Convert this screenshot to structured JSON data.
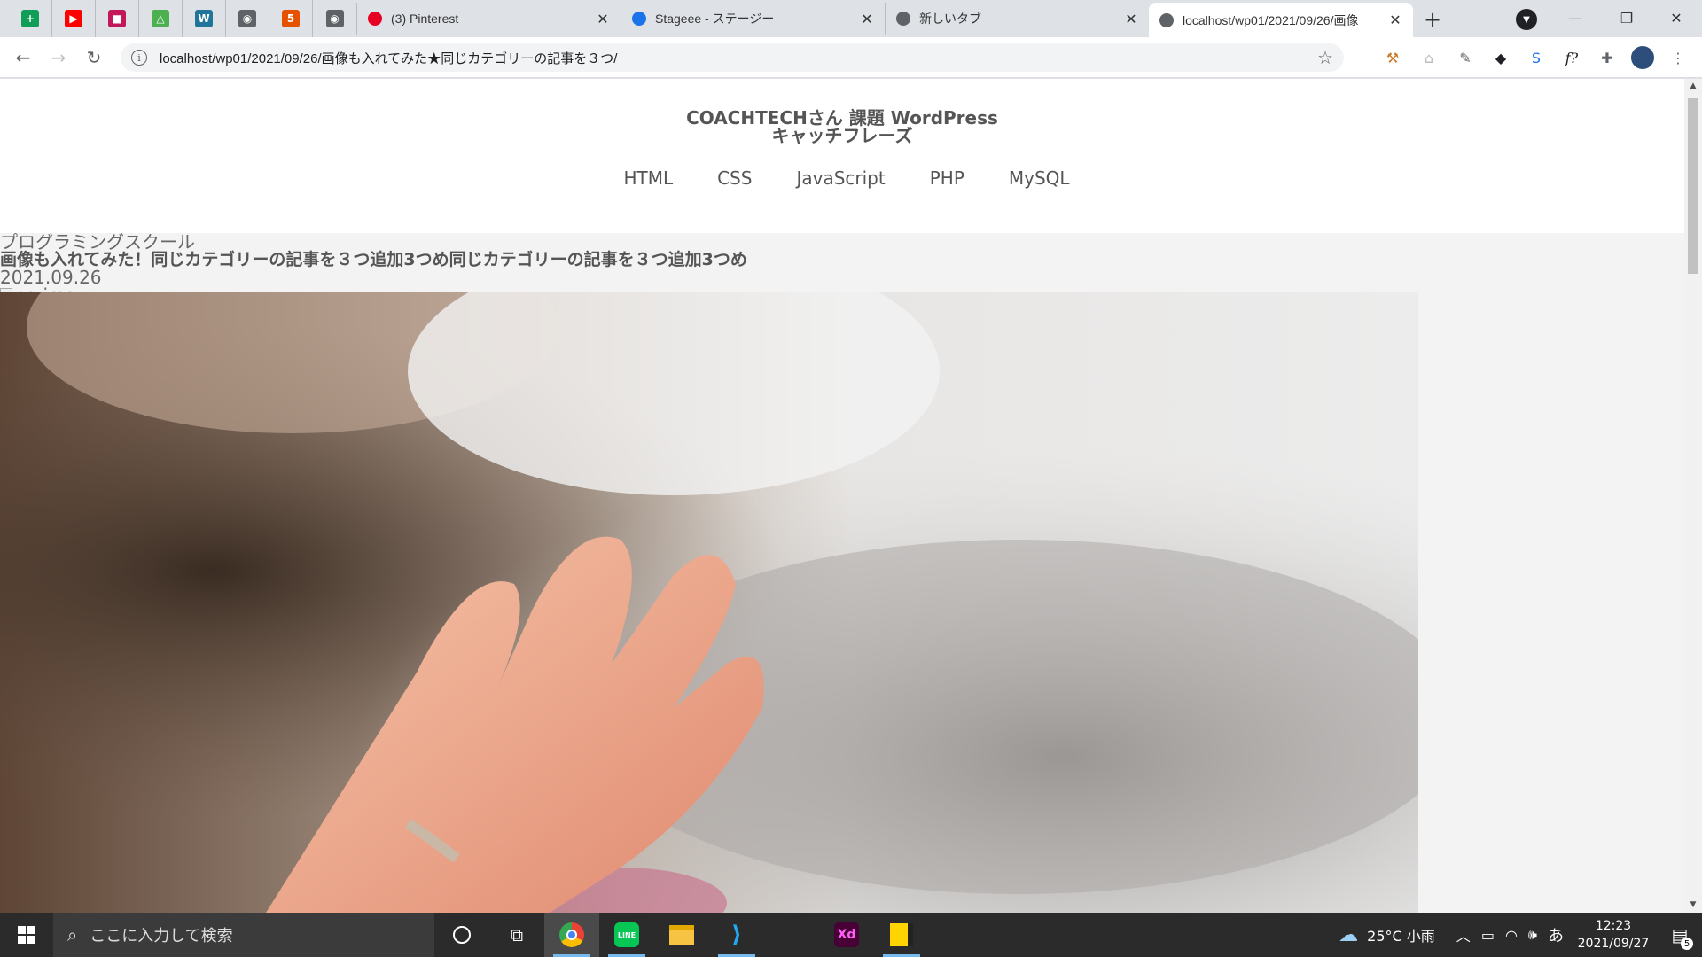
{
  "browser": {
    "pinned_tabs": [
      {
        "icon": "google-sheets-icon",
        "color": "#0f9d58",
        "glyph": "+"
      },
      {
        "icon": "youtube-icon",
        "color": "#ff0000",
        "glyph": "▶"
      },
      {
        "icon": "book-icon",
        "color": "#c2185b",
        "glyph": "■"
      },
      {
        "icon": "drive-icon",
        "color": "#4caf50",
        "glyph": "△"
      },
      {
        "icon": "wordpress-icon",
        "color": "#21759b",
        "glyph": "W"
      },
      {
        "icon": "globe-icon",
        "color": "#5f6368",
        "glyph": "◉"
      },
      {
        "icon": "html5-icon",
        "color": "#e65100",
        "glyph": "5"
      },
      {
        "icon": "globe-icon",
        "color": "#5f6368",
        "glyph": "◉"
      }
    ],
    "tabs": [
      {
        "title": "(3) Pinterest",
        "icon": "pinterest-icon",
        "color": "#e60023",
        "active": false
      },
      {
        "title": "Stageee - ステージー",
        "icon": "stageee-icon",
        "color": "#1a73e8",
        "active": false
      },
      {
        "title": "新しいタブ",
        "icon": "chrome-icon",
        "color": "#5f6368",
        "active": false
      },
      {
        "title": "localhost/wp01/2021/09/26/画像",
        "icon": "globe-icon",
        "color": "#5f6368",
        "active": true
      }
    ],
    "url": "localhost/wp01/2021/09/26/画像も入れてみた★同じカテゴリーの記事を３つ/"
  },
  "site": {
    "title": "COACHTECHさん 課題 WordPress",
    "catchphrase": "キャッチフレーズ",
    "nav": [
      "HTML",
      "CSS",
      "JavaScript",
      "PHP",
      "MySQL"
    ]
  },
  "post": {
    "category": "プログラミングスクール",
    "title": "画像も入れてみた！同じカテゴリーの記事を３つ追加3つめ同じカテゴリーの記事を３つ追加3つめ",
    "date": "2021.09.26",
    "img_alt": "no-img"
  },
  "taskbar": {
    "search_placeholder": "ここに入力して検索",
    "weather": "25°C 小雨",
    "ime": "あ",
    "time": "12:23",
    "date": "2021/09/27",
    "notifications": "5"
  }
}
